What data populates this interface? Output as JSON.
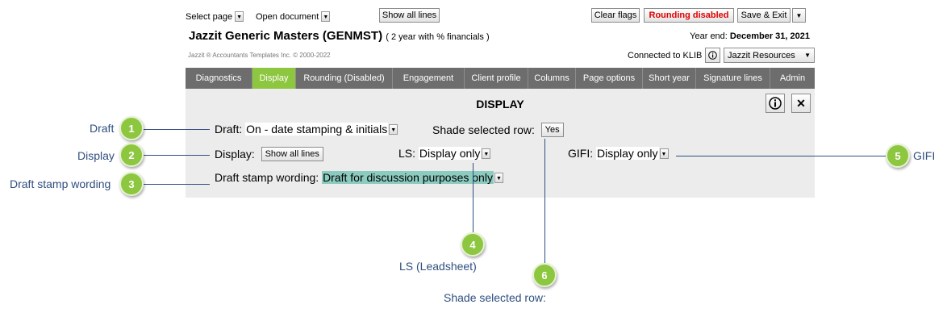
{
  "toolbar": {
    "select_page": "Select page",
    "open_document": "Open document",
    "show_all_lines": "Show all lines",
    "clear_flags": "Clear flags",
    "rounding_disabled": "Rounding disabled",
    "save_exit": "Save & Exit"
  },
  "header": {
    "title": "Jazzit Generic Masters (GENMST)",
    "subtitle": "( 2 year with % financials )",
    "year_end_label": "Year end:",
    "year_end_value": "December 31, 2021",
    "copyright": "Jazzit ®  Accountants Templates Inc.  © 2000-2022",
    "connected": "Connected to KLIB",
    "resources": "Jazzit Resources"
  },
  "tabs": [
    {
      "label": "Diagnostics"
    },
    {
      "label": "Display"
    },
    {
      "label": "Rounding (Disabled)"
    },
    {
      "label": "Engagement"
    },
    {
      "label": "Client profile"
    },
    {
      "label": "Columns"
    },
    {
      "label": "Page options"
    },
    {
      "label": "Short year"
    },
    {
      "label": "Signature lines"
    },
    {
      "label": "Admin"
    }
  ],
  "active_tab": "Display",
  "panel": {
    "title": "DISPLAY",
    "draft_label": "Draft:",
    "draft_value": "On - date stamping & initials",
    "shade_label": "Shade selected row:",
    "shade_value": "Yes",
    "display_label": "Display:",
    "display_value": "Show all lines",
    "ls_label": "LS:",
    "ls_value": "Display only",
    "gifi_label": "GIFI:",
    "gifi_value": "Display only",
    "wording_label": "Draft stamp wording:",
    "wording_value": "Draft for discussion purposes only"
  },
  "callouts": [
    {
      "number": "1",
      "label": "Draft"
    },
    {
      "number": "2",
      "label": "Display"
    },
    {
      "number": "3",
      "label": "Draft stamp wording"
    },
    {
      "number": "4",
      "label": "LS (Leadsheet)"
    },
    {
      "number": "5",
      "label": "GIFI"
    },
    {
      "number": "6",
      "label": "Shade selected row:"
    }
  ],
  "colors": {
    "tab_bar": "#6d6d6d",
    "active_tab": "#8dc63f",
    "panel_bg": "#ececec",
    "callout": "#8dc63f",
    "callout_text": "#2f4f7f",
    "highlight": "#8ccbbf",
    "alert_red": "#e00000"
  },
  "icons": {
    "dropdown": "chevron-down-icon",
    "info": "info-icon",
    "close": "close-icon"
  }
}
